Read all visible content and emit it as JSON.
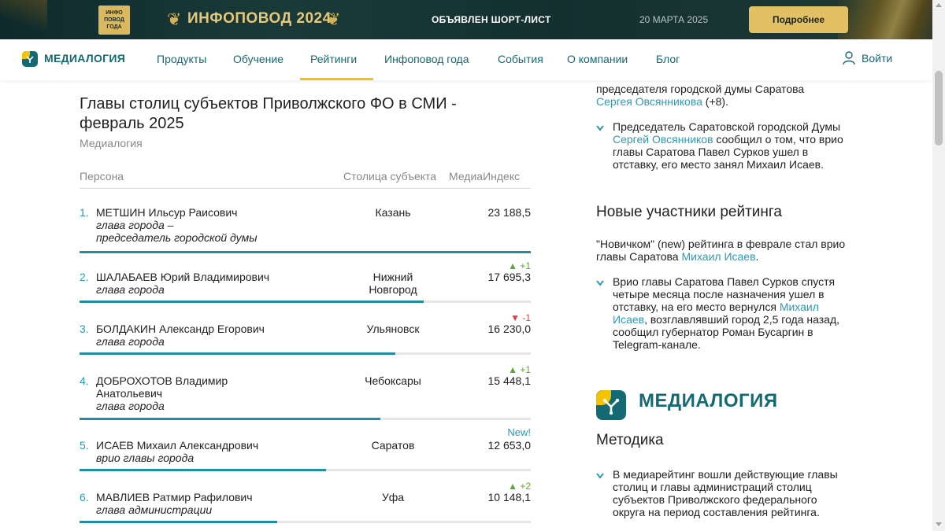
{
  "banner": {
    "badge": "ИНФО ПОВОД ГОДА",
    "title": "ИНФОПОВОД 2024",
    "shortlist": "ОБЪЯВЛЕН ШОРТ-ЛИСТ",
    "date": "20 МАРТА 2025",
    "button": "Подробнее"
  },
  "nav": {
    "logo": "МЕДИАЛОГИЯ",
    "items": [
      "Продукты",
      "Обучение",
      "Рейтинги",
      "Инфоповод года",
      "События",
      "О компании",
      "Блог"
    ],
    "active": "Рейтинги",
    "login": "Войти"
  },
  "main": {
    "title_line1": "Главы столиц субъектов Приволжского ФО в СМИ -",
    "title_line2": "февраль 2025",
    "source": "Медиалогия",
    "columns": [
      "Персона",
      "Столица субъекта",
      "МедиаИндекс"
    ],
    "rows": [
      {
        "rank": "1.",
        "name": "МЕТШИН Ильсур Раисович",
        "role_line1": "глава города –",
        "role_line2": "председатель городской думы",
        "city": "Казань",
        "city2": "",
        "value": "23 188,5",
        "delta": "",
        "progress": 1.0
      },
      {
        "rank": "2.",
        "name": "ШАЛАБАЕВ Юрий Владимирович",
        "role_line1": "глава города",
        "role_line2": "",
        "city": "Нижний",
        "city2": "Новгород",
        "value": "17 695,3",
        "delta": "+1",
        "progress": 0.763
      },
      {
        "rank": "3.",
        "name": "БОЛДАКИН Александр Егорович",
        "role_line1": "глава города",
        "role_line2": "",
        "city": "Ульяновск",
        "city2": "",
        "value": "16 230,0",
        "delta": "-1",
        "progress": 0.7
      },
      {
        "rank": "4.",
        "name": "ДОБРОХОТОВ Владимир",
        "name2": "Анатольевич",
        "role_line1": "глава города",
        "role_line2": "",
        "city": "Чебоксары",
        "city2": "",
        "value": "15 448,1",
        "delta": "+1",
        "progress": 0.666
      },
      {
        "rank": "5.",
        "name": "ИСАЕВ Михаил Александрович",
        "role_line1": "врио главы города",
        "role_line2": "",
        "city": "Саратов",
        "city2": "",
        "value": "12 653,0",
        "delta": "New!",
        "progress": 0.546
      },
      {
        "rank": "6.",
        "name": "МАВЛИЕВ Ратмир Рафилович",
        "role_line1": "глава администрации",
        "role_line2": "",
        "city": "Уфа",
        "city2": "",
        "value": "10 148,1",
        "delta": "+2",
        "progress": 0.438
      }
    ]
  },
  "side": {
    "top_fragment_text": "председателя городской думы Саратова",
    "top_fragment_link": "Сергея Овсянникова",
    "top_fragment_suffix": " (+8).",
    "bullet1_pre": "Председатель Саратовской городской Думы ",
    "bullet1_link": "Сергей Овсянников",
    "bullet1_post": " сообщил о том, что врио главы Саратова Павел Сурков ушел в отставку, его место занял Михаил Исаев.",
    "new_heading": "Новые участники рейтинга",
    "new_text_pre": "\"Новичком\" (new) рейтинга в феврале стал врио главы Саратова ",
    "new_text_link": "Михаил Исаев",
    "new_text_post": ".",
    "bullet2_pre": "Врио главы Саратова Павел Сурков спустя четыре месяца после назначения ушел в отставку, на его место вернулся ",
    "bullet2_link": "Михаил Исаев",
    "bullet2_post": ", возглавлявший город 2,5 года назад, сообщил губернатор Роман Бусаргин в Telegram-канале.",
    "big_logo": "МЕДИАЛОГИЯ",
    "method_heading": "Методика",
    "bullet3": "В медиарейтинг вошли действующие главы столиц и главы администраций столиц субъектов Приволжского федерального округа на период составления рейтинга."
  },
  "colors": {
    "accent": "#146a73",
    "link": "#2a9bb4",
    "gold": "#e1c164",
    "up": "#5aa92e",
    "down": "#e04040"
  }
}
